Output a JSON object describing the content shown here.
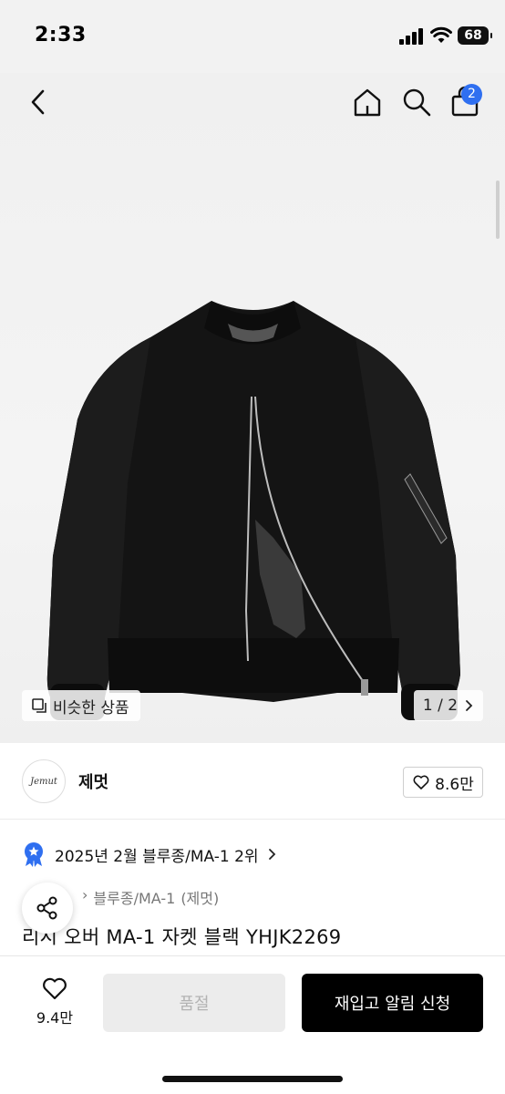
{
  "status_bar": {
    "time": "2:33",
    "battery": "68"
  },
  "nav": {
    "cart_count": "2"
  },
  "hero": {
    "similar_label": "비슷한 상품",
    "pager": "1 / 2"
  },
  "brand": {
    "logo_text": "Jemut",
    "name": "제멋",
    "likes": "8.6만"
  },
  "product": {
    "ranking": "2025년 2월 블루종/MA-1 2위",
    "breadcrumb_category": "블루종/MA-1",
    "breadcrumb_brand": "(제멋)",
    "title": "리시 오버 MA-1 자켓 블랙 YHJK2269"
  },
  "bottom_bar": {
    "wish_count": "9.4만",
    "soldout_label": "품절",
    "restock_label": "재입고 알림 신청"
  },
  "colors": {
    "accent": "#2f6ff0",
    "primary_button": "#000000",
    "disabled_button": "#ececec"
  }
}
